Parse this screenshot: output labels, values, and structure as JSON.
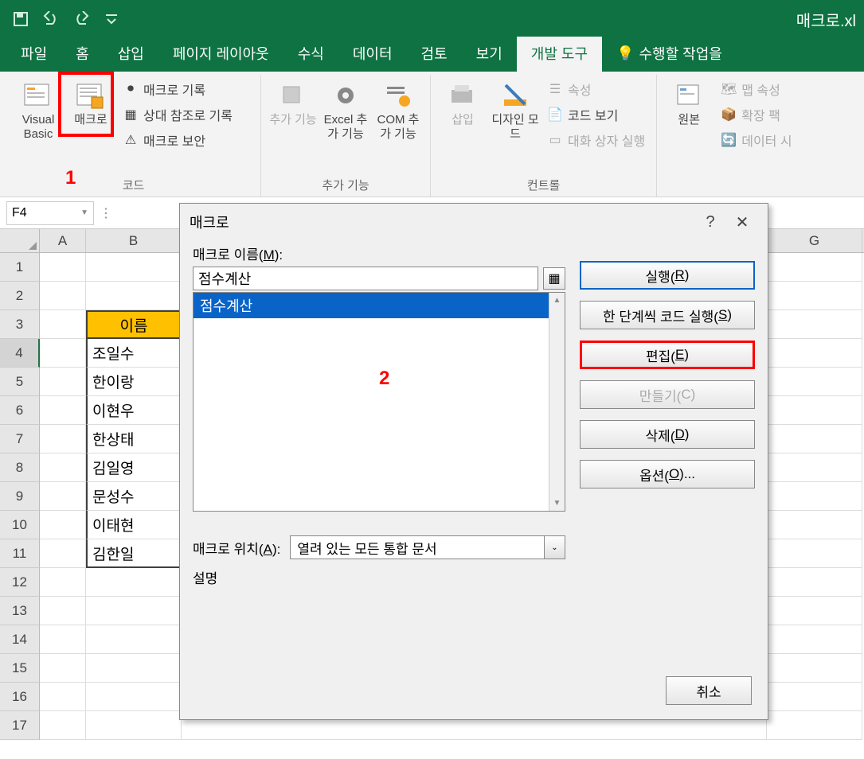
{
  "titlebar": {
    "filename": "매크로.xl"
  },
  "tabs": {
    "file": "파일",
    "home": "홈",
    "insert": "삽입",
    "pagelayout": "페이지 레이아웃",
    "formulas": "수식",
    "data": "데이터",
    "review": "검토",
    "view": "보기",
    "developer": "개발 도구",
    "tellme": "수행할 작업을"
  },
  "ribbon": {
    "code": {
      "vb": "Visual Basic",
      "macros": "매크로",
      "record": "매크로 기록",
      "relative": "상대 참조로 기록",
      "security": "매크로 보안",
      "group": "코드"
    },
    "addins": {
      "addins": "추가 기능",
      "excel": "Excel 추가 기능",
      "com": "COM 추가 기능",
      "group": "추가 기능"
    },
    "controls": {
      "insert": "삽입",
      "design": "디자인 모드",
      "props": "속성",
      "viewcode": "코드 보기",
      "rundlg": "대화 상자 실행",
      "group": "컨트롤"
    },
    "xml": {
      "source": "원본",
      "mapprops": "맵 속성",
      "expansion": "확장 팩",
      "refresh": "데이터 시"
    }
  },
  "annotations": {
    "n1": "1",
    "n2": "2"
  },
  "namebox": "F4",
  "columns": [
    "A",
    "B",
    "G"
  ],
  "rowData": {
    "header": "이름",
    "names": [
      "조일수",
      "한이랑",
      "이현우",
      "한상태",
      "김일영",
      "문성수",
      "이태현",
      "김한일"
    ]
  },
  "dialog": {
    "title": "매크로",
    "nameLabelPre": "매크로 이름(",
    "nameLabelKey": "M",
    "nameLabelPost": "):",
    "nameValue": "점수계산",
    "listItem": "점수계산",
    "locLabelPre": "매크로 위치(",
    "locLabelKey": "A",
    "locLabelPost": "):",
    "locValue": "열려 있는 모든 통합 문서",
    "descLabel": "설명",
    "buttons": {
      "runPre": "실행(",
      "runKey": "R",
      "runPost": ")",
      "stepPre": "한 단계씩 코드 실행(",
      "stepKey": "S",
      "stepPost": ")",
      "editPre": "편집(",
      "editKey": "E",
      "editPost": ")",
      "createPre": "만들기(",
      "createKey": "C",
      "createPost": ")",
      "deletePre": "삭제(",
      "deleteKey": "D",
      "deletePost": ")",
      "optionsPre": "옵션(",
      "optionsKey": "O",
      "optionsPost": ")...",
      "cancel": "취소"
    }
  }
}
